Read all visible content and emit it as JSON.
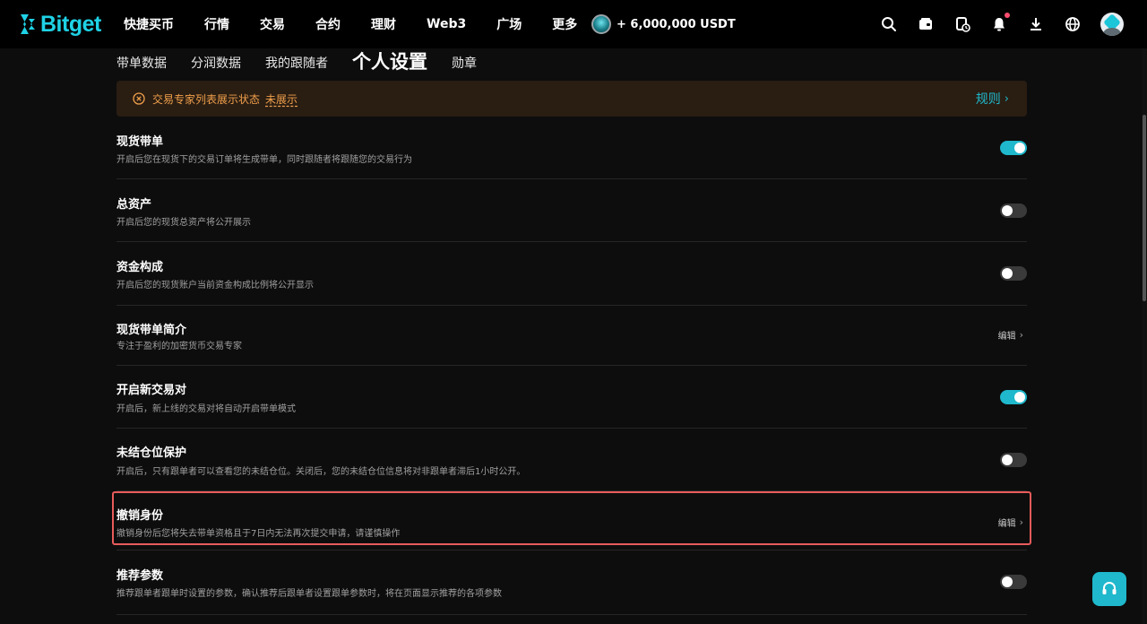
{
  "brand": {
    "name": "Bitget",
    "accent": "#1fd2e6"
  },
  "nav": {
    "items": [
      {
        "label": "快捷买币"
      },
      {
        "label": "行情"
      },
      {
        "label": "交易"
      },
      {
        "label": "合约"
      },
      {
        "label": "理财"
      },
      {
        "label": "Web3"
      },
      {
        "label": "广场"
      },
      {
        "label": "更多"
      }
    ],
    "promo_text": "+ 6,000,000 USDT",
    "icons": [
      "search-icon",
      "wallet-icon",
      "history-icon",
      "bell-icon",
      "download-icon",
      "globe-icon",
      "avatar"
    ]
  },
  "subtabs": [
    {
      "label": "带单数据",
      "active": false
    },
    {
      "label": "分润数据",
      "active": false
    },
    {
      "label": "我的跟随者",
      "active": false
    },
    {
      "label": "个人设置",
      "active": true
    },
    {
      "label": "勋章",
      "active": false
    }
  ],
  "notice": {
    "label": "交易专家列表展示状态",
    "status": "未展示",
    "rule_label": "规则",
    "color": "#f0a04b"
  },
  "settings": [
    {
      "title": "现货带单",
      "desc": "开启后您在现货下的交易订单将生成带单，同时跟随者将跟随您的交易行为",
      "control": "toggle",
      "on": true
    },
    {
      "title": "总资产",
      "desc": "开启后您的现货总资产将公开展示",
      "control": "toggle",
      "on": false
    },
    {
      "title": "资金构成",
      "desc": "开启后您的现货账户当前资金构成比例将公开显示",
      "control": "toggle",
      "on": false
    },
    {
      "title": "现货带单简介",
      "desc": "专注于盈利的加密货币交易专家",
      "control": "edit",
      "edit_label": "编辑"
    },
    {
      "title": "开启新交易对",
      "desc": "开启后，新上线的交易对将自动开启带单模式",
      "control": "toggle",
      "on": true
    },
    {
      "title": "未结仓位保护",
      "desc": "开启后，只有跟单者可以查看您的未结仓位。关闭后，您的未结仓位信息将对非跟单者滞后1小时公开。",
      "control": "toggle",
      "on": false
    },
    {
      "title": "撤销身份",
      "desc": "撤销身份后您将失去带单资格且于7日内无法再次提交申请，请谨慎操作",
      "control": "edit",
      "edit_label": "编辑",
      "highlighted": true
    },
    {
      "title": "推荐参数",
      "desc": "推荐跟单者跟单时设置的参数，确认推荐后跟单者设置跟单参数时，将在页面显示推荐的各项参数",
      "control": "toggle",
      "on": false
    }
  ],
  "colors": {
    "toggle_on": "#1fb8cc",
    "toggle_off": "#3a3a3a",
    "highlight": "#e85b5b"
  }
}
